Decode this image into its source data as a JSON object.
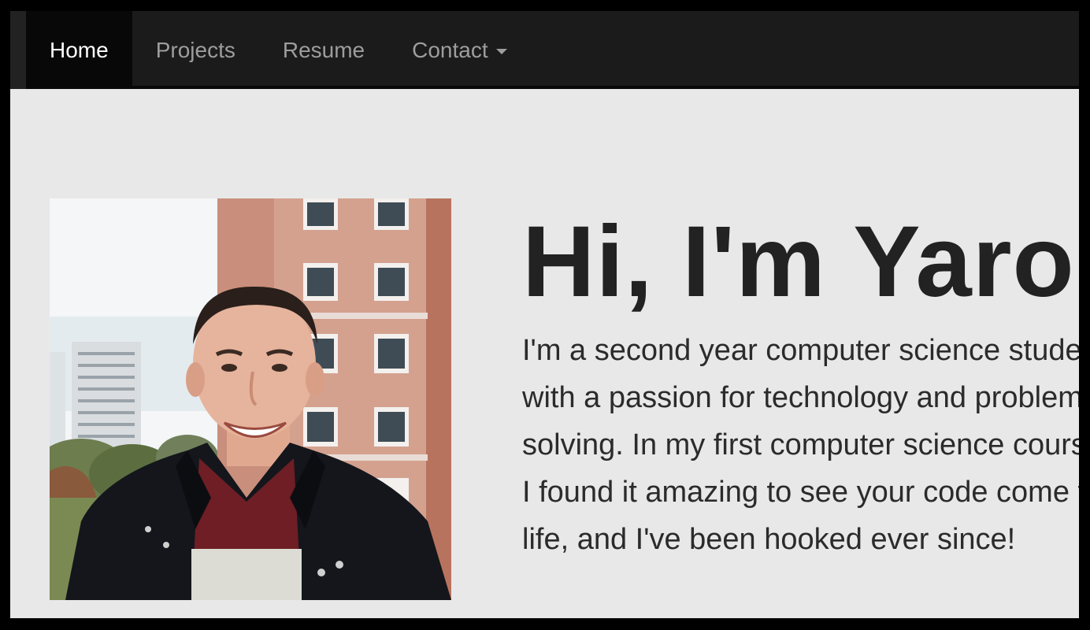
{
  "nav": {
    "items": [
      {
        "label": "Home",
        "active": true
      },
      {
        "label": "Projects",
        "active": false
      },
      {
        "label": "Resume",
        "active": false
      },
      {
        "label": "Contact",
        "active": false,
        "has_dropdown": true
      }
    ]
  },
  "hero": {
    "headline": "Hi, I'm Yaron",
    "bio": "I'm a second year computer science student with a passion for technology and problem solving. In my first computer science course, I found it amazing to see your code come to life, and I've been hooked ever since!",
    "photo_icon": "profile-photo"
  },
  "colors": {
    "navbar": "#1b1b1b",
    "nav_active": "#080808",
    "nav_text": "#9d9d9d",
    "nav_active_text": "#ffffff",
    "page_background": "#e8e8e8",
    "text": "#222222"
  }
}
